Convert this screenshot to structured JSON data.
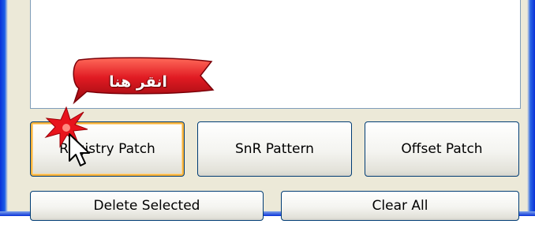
{
  "buttons": {
    "registry_patch": "Registry Patch",
    "snr_pattern": "SnR Pattern",
    "offset_patch": "Offset Patch",
    "delete_selected": "Delete Selected",
    "clear_all": "Clear All"
  },
  "annotation": {
    "callout_text": "انقر هنا"
  },
  "colors": {
    "window_frame": "#0831d9",
    "button_border": "#003c74",
    "focus_highlight": "#f8b33a",
    "callout_red": "#e01a22"
  },
  "icons": [
    "mouse-pointer-icon",
    "click-burst-icon"
  ]
}
